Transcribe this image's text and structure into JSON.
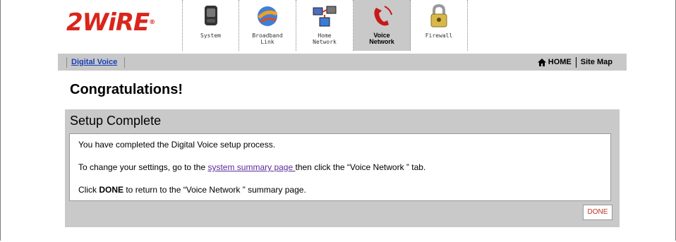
{
  "brand": {
    "logo_text": "2WiRE",
    "logo_mark": "®"
  },
  "tabs": [
    {
      "label": "System",
      "icon": "system-icon",
      "active": false
    },
    {
      "label": "Broadband Link",
      "icon": "broadband-globe-icon",
      "active": false
    },
    {
      "label": "Home Network",
      "icon": "home-network-icon",
      "active": false
    },
    {
      "label": "Voice Network",
      "icon": "phone-icon",
      "active": true
    },
    {
      "label": "Firewall",
      "icon": "padlock-icon",
      "active": false
    }
  ],
  "nav": {
    "breadcrumb": "Digital Voice",
    "home_label": "HOME",
    "sitemap_label": "Site Map"
  },
  "page": {
    "title": "Congratulations!"
  },
  "panel": {
    "heading": "Setup Complete",
    "line1": "You have completed the Digital Voice setup process.",
    "line2_before": "To change your settings, go to the ",
    "line2_link": "system summary page ",
    "line2_after": "then click the “Voice Network ” tab.",
    "line3_before": "Click ",
    "line3_bold": "DONE",
    "line3_after": " to return to the “Voice Network ” summary page.",
    "done_label": "DONE"
  },
  "colors": {
    "brand_red": "#d9261c",
    "panel_gray": "#c9c9c9",
    "link_blue": "#1a3fb8",
    "visited_link": "#5a2d9c"
  }
}
